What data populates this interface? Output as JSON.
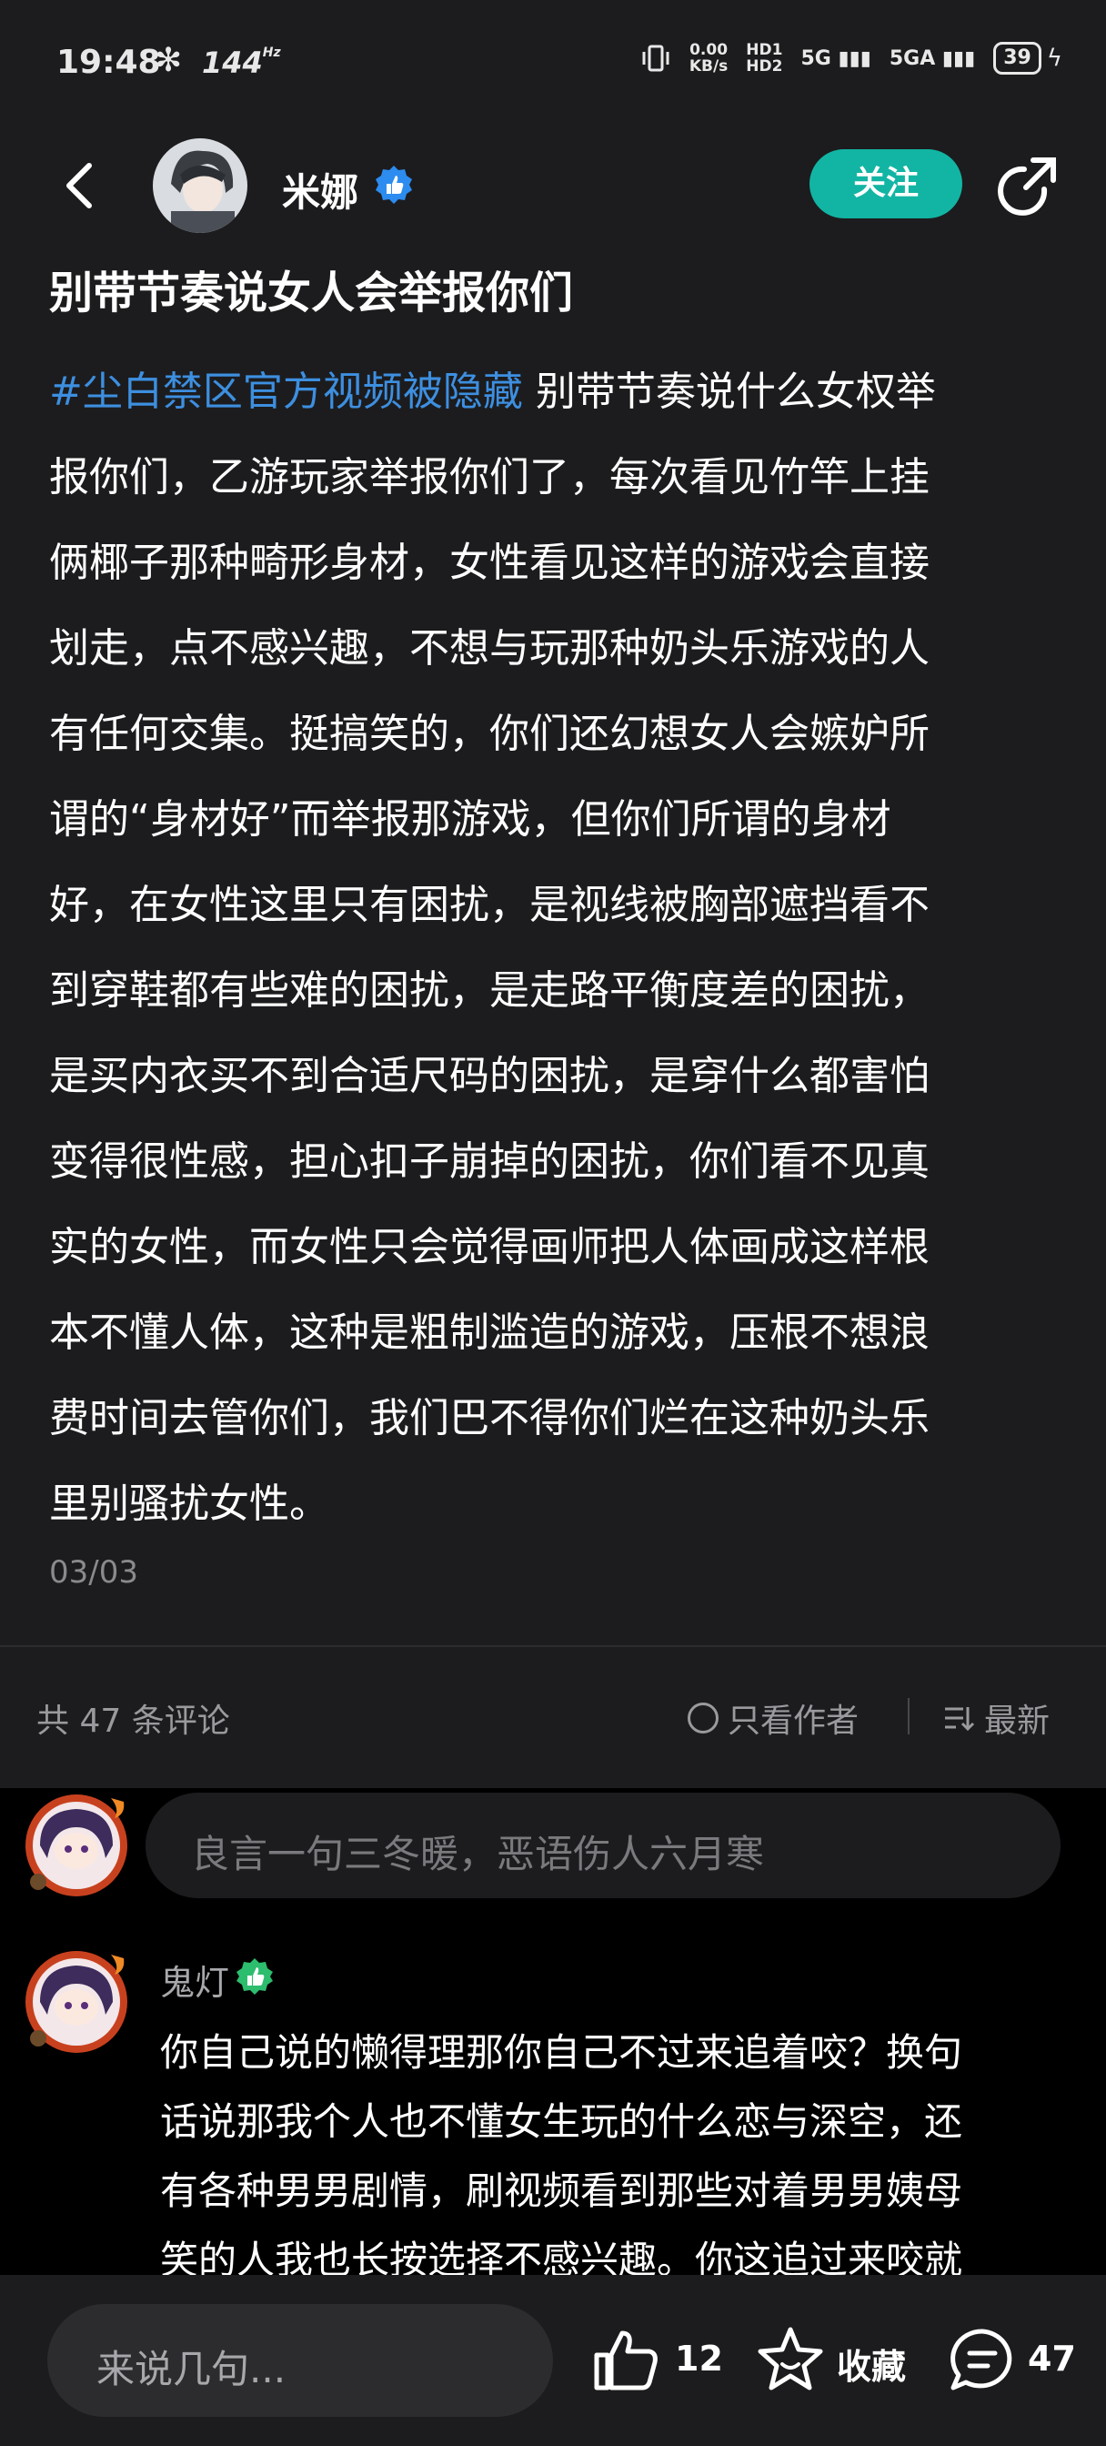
{
  "status_bar": {
    "time": "19:48",
    "refresh_rate": "144",
    "refresh_unit": "Hz",
    "speed_value": "0.00",
    "speed_unit": "KB/s",
    "hd1": "HD1",
    "hd2": "HD2",
    "sig1": "5G",
    "sig2": "5GA",
    "battery": "39"
  },
  "header": {
    "author_name": "米娜",
    "follow_label": "关注"
  },
  "post": {
    "title": "别带节奏说女人会举报你们",
    "hashtag": "#尘白禁区官方视频被隐藏",
    "body_lines": [
      " 别带节奏说什么女权举",
      "报你们，乙游玩家举报你们了，每次看见竹竿上挂",
      "俩椰子那种畸形身材，女性看见这样的游戏会直接",
      "划走，点不感兴趣，不想与玩那种奶头乐游戏的人",
      "有任何交集。挺搞笑的，你们还幻想女人会嫉妒所",
      "谓的“身材好”而举报那游戏，但你们所谓的身材",
      "好，在女性这里只有困扰，是视线被胸部遮挡看不",
      "到穿鞋都有些难的困扰，是走路平衡度差的困扰，",
      "是买内衣买不到合适尺码的困扰，是穿什么都害怕",
      "变得很性感，担心扣子崩掉的困扰，你们看不见真",
      "实的女性，而女性只会觉得画师把人体画成这样根",
      "本不懂人体，这种是粗制滥造的游戏，压根不想浪",
      "费时间去管你们，我们巴不得你们烂在这种奶头乐",
      "里别骚扰女性。"
    ],
    "image_counter": "03/03"
  },
  "comments_bar": {
    "count_label": "共 47 条评论",
    "only_author_label": "只看作者",
    "sort_label": "最新"
  },
  "comment_input": {
    "placeholder": "良言一句三冬暖，恶语伤人六月寒"
  },
  "comments": [
    {
      "name": "鬼灯",
      "lines": [
        "你自己说的懒得理那你自己不过来追着咬？换句",
        "话说那我个人也不懂女生玩的什么恋与深空，还",
        "有各种男男剧情，刷视频看到那些对着男男姨母",
        "笑的人我也长按选择不感兴趣。你这追过来咬就"
      ]
    }
  ],
  "bottom_bar": {
    "say_placeholder": "来说几句...",
    "like_count": "12",
    "favorite_label": "收藏",
    "comment_count": "47"
  },
  "colors": {
    "accent": "#12b5a3",
    "hashtag": "#3d8fe0",
    "verified": "#2d8cf0",
    "badge": "#2dbd6e"
  }
}
